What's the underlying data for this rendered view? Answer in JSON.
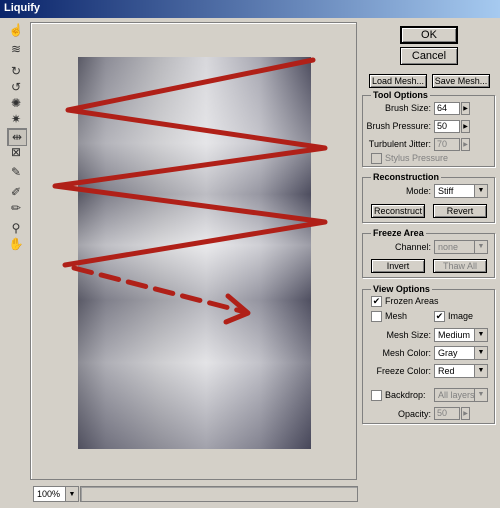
{
  "window": {
    "title": "Liquify"
  },
  "tools": [
    {
      "icon": "warp-icon",
      "glyph": "☝"
    },
    {
      "icon": "turbulence-icon",
      "glyph": "≋"
    },
    {
      "icon": "twirl-clockwise-icon",
      "glyph": "↻"
    },
    {
      "icon": "twirl-counterclockwise-icon",
      "glyph": "↺"
    },
    {
      "icon": "pucker-icon",
      "glyph": "✺"
    },
    {
      "icon": "bloat-icon",
      "glyph": "✷"
    },
    {
      "icon": "shift-pixels-icon",
      "glyph": "⇹"
    },
    {
      "icon": "reflection-icon",
      "glyph": "⊠"
    },
    {
      "icon": "reconstruct-icon",
      "glyph": "✎"
    },
    {
      "icon": "freeze-icon",
      "glyph": "✐"
    },
    {
      "icon": "thaw-icon",
      "glyph": "✏"
    },
    {
      "icon": "zoom-icon",
      "glyph": "⚲"
    },
    {
      "icon": "hand-icon",
      "glyph": "✋"
    }
  ],
  "zoom": {
    "value": "100%"
  },
  "buttons": {
    "ok": "OK",
    "cancel": "Cancel",
    "load_mesh": "Load Mesh...",
    "save_mesh": "Save Mesh..."
  },
  "tool_options": {
    "title": "Tool Options",
    "brush_size_label": "Brush Size:",
    "brush_size": "64",
    "brush_pressure_label": "Brush Pressure:",
    "brush_pressure": "50",
    "turbulent_jitter_label": "Turbulent Jitter:",
    "turbulent_jitter": "70",
    "stylus_pressure_label": "Stylus Pressure"
  },
  "reconstruction": {
    "title": "Reconstruction",
    "mode_label": "Mode:",
    "mode": "Stiff",
    "reconstruct": "Reconstruct",
    "revert": "Revert"
  },
  "freeze_area": {
    "title": "Freeze Area",
    "channel_label": "Channel:",
    "channel": "none",
    "invert": "Invert",
    "thaw_all": "Thaw All"
  },
  "view_options": {
    "title": "View Options",
    "frozen_areas_label": "Frozen Areas",
    "mesh_label": "Mesh",
    "image_label": "Image",
    "mesh_size_label": "Mesh Size:",
    "mesh_size": "Medium",
    "mesh_color_label": "Mesh Color:",
    "mesh_color": "Gray",
    "freeze_color_label": "Freeze Color:",
    "freeze_color": "Red",
    "backdrop_label": "Backdrop:",
    "backdrop": "All layers",
    "opacity_label": "Opacity:",
    "opacity": "50"
  },
  "colors": {
    "annotation_stroke": "#b02018",
    "titlebar": "#0a246a"
  }
}
